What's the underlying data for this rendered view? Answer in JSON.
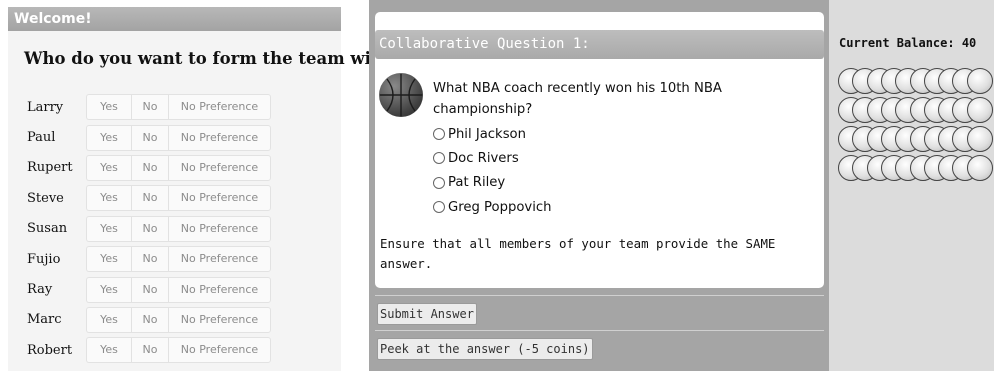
{
  "left_panel": {
    "welcome": "Welcome!",
    "question": "Who do you want to form the team with?",
    "option_labels": {
      "yes": "Yes",
      "no": "No",
      "no_preference": "No Preference"
    },
    "members": [
      "Larry",
      "Paul",
      "Rupert",
      "Steve",
      "Susan",
      "Fujio",
      "Ray",
      "Marc",
      "Robert"
    ]
  },
  "question_panel": {
    "header": "Collaborative Question 1:",
    "question": "What NBA coach recently won his 10th NBA championship?",
    "choices": [
      "Phil Jackson",
      "Doc Rivers",
      "Pat Riley",
      "Greg Poppovich"
    ],
    "instruction": "Ensure that all members of your team provide the SAME answer.",
    "submit_label": "Submit Answer",
    "peek_label": "Peek at the answer (-5 coins)",
    "icon": "basketball-icon"
  },
  "balance_panel": {
    "label": "Current Balance: 40",
    "coins": 40,
    "coin_rows": 4,
    "coins_per_row": 10,
    "icon": "coin-icon"
  }
}
